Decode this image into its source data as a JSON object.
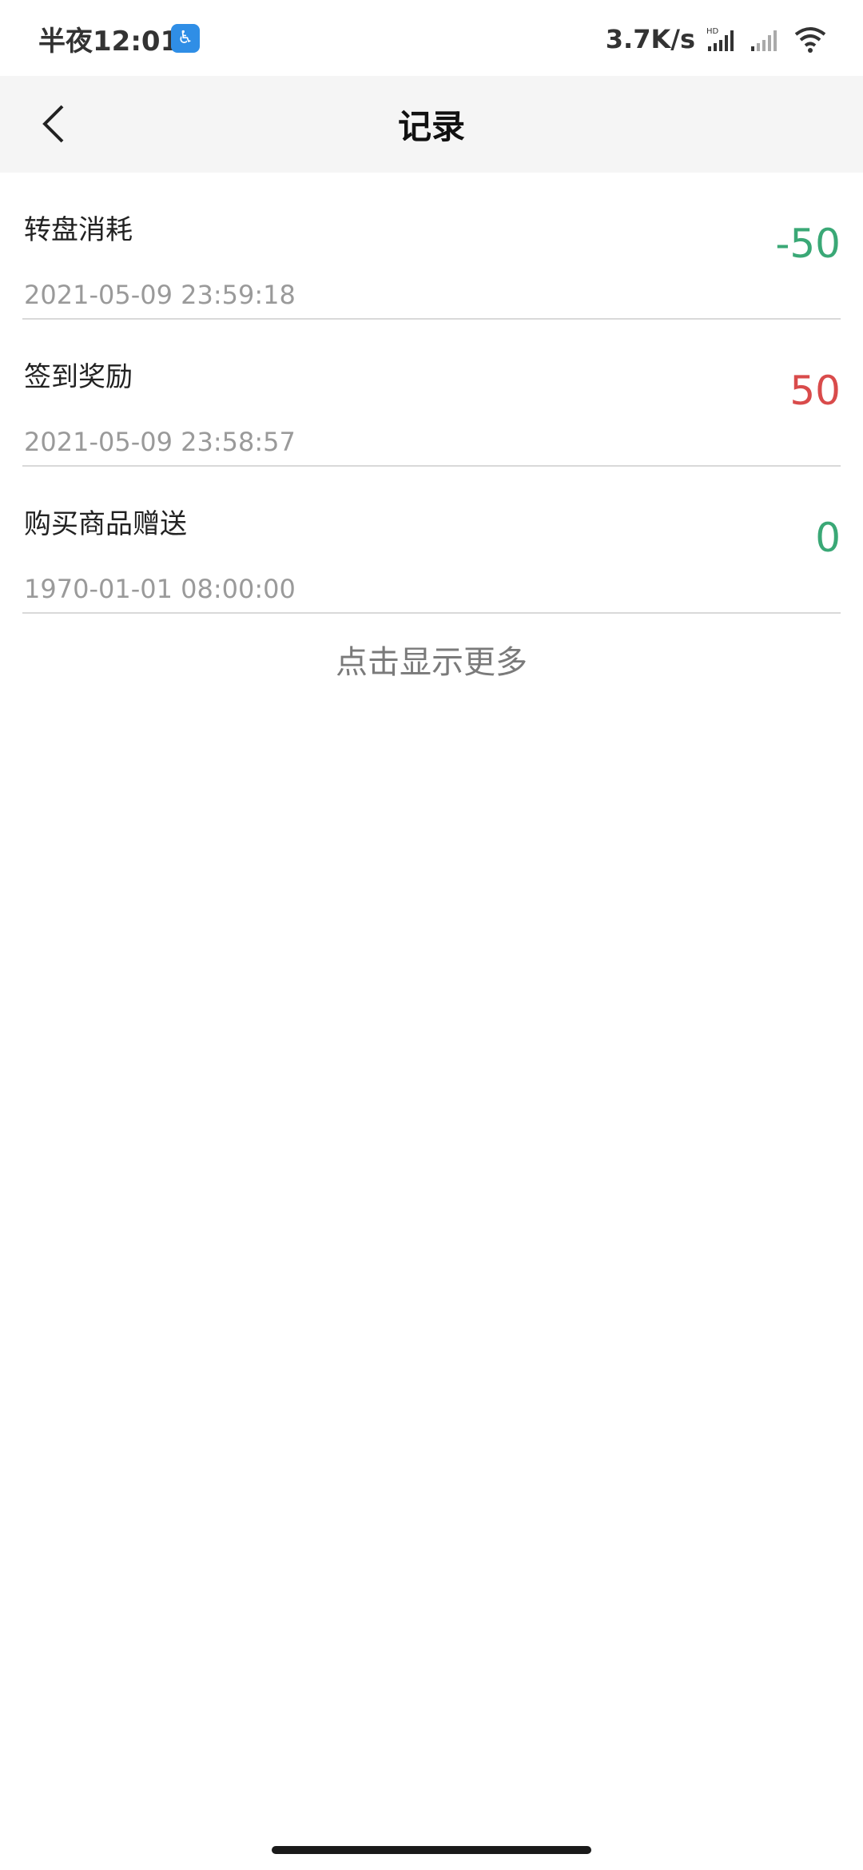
{
  "status_bar": {
    "time": "半夜12:01",
    "net_speed": "3.7K/s"
  },
  "header": {
    "title": "记录"
  },
  "records": [
    {
      "title": "转盘消耗",
      "time": "2021-05-09 23:59:18",
      "amount": "-50",
      "color": "#3aa876"
    },
    {
      "title": "签到奖励",
      "time": "2021-05-09 23:58:57",
      "amount": "50",
      "color": "#d94b4b"
    },
    {
      "title": "购买商品赠送",
      "time": "1970-01-01 08:00:00",
      "amount": "0",
      "color": "#3aa876"
    }
  ],
  "show_more_label": "点击显示更多",
  "colors": {
    "negative_or_zero": "#3aa876",
    "positive": "#d94b4b",
    "accent_progress": "#56c41e"
  }
}
